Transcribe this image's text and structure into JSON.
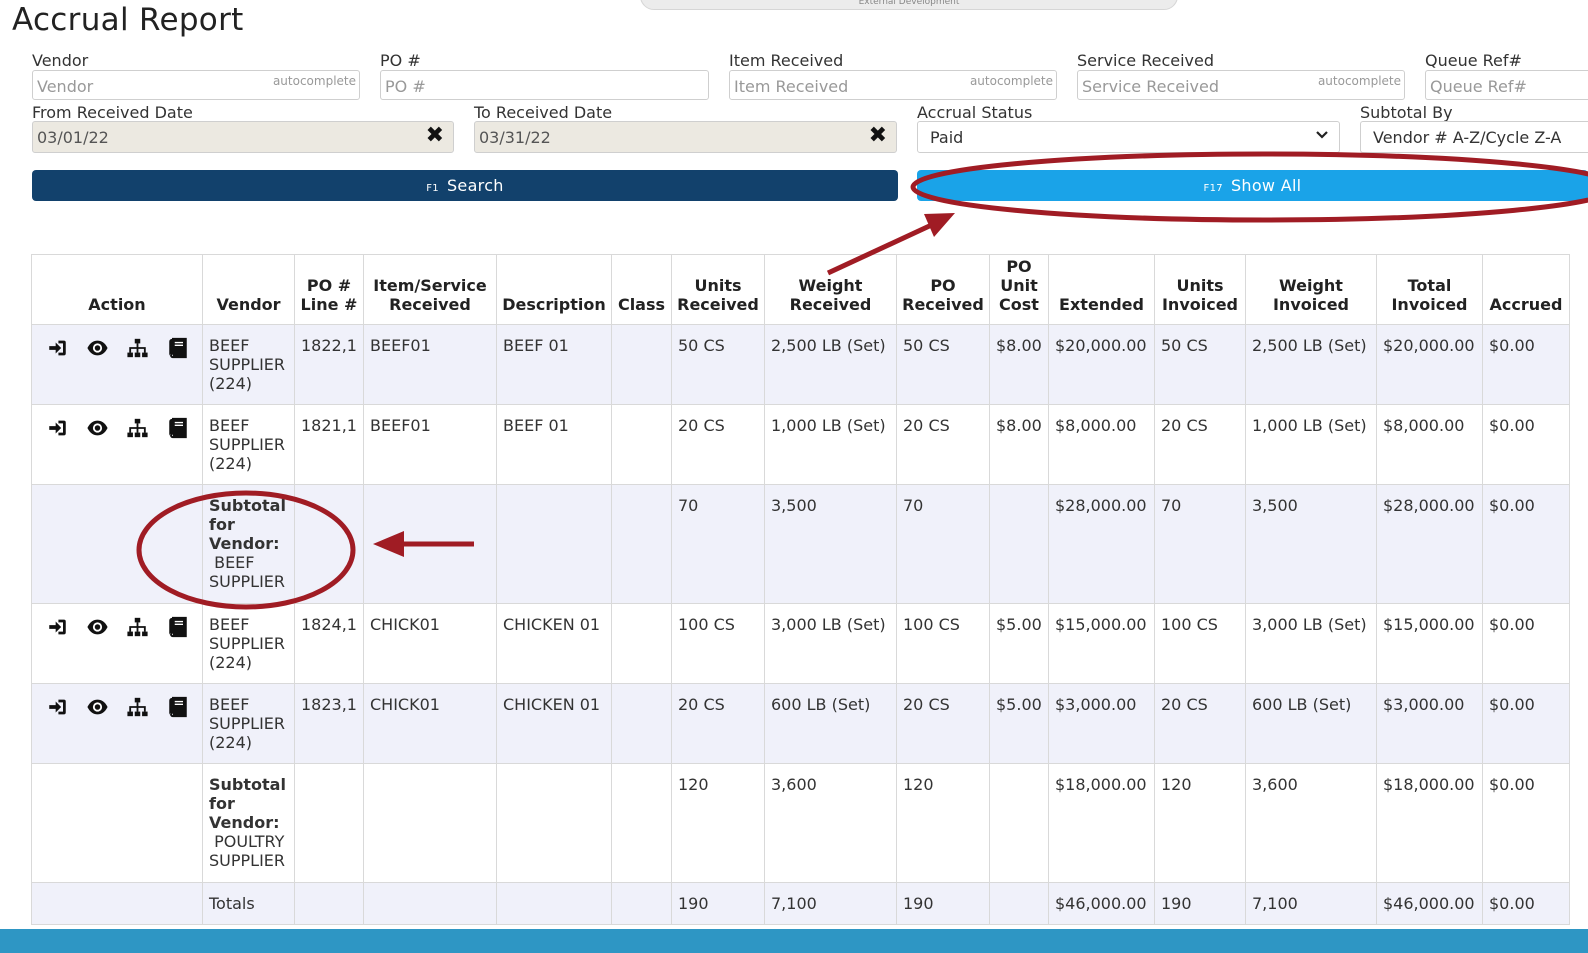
{
  "environment_tab": "External Development",
  "title": "Accrual Report",
  "filters": {
    "vendor": {
      "label": "Vendor",
      "placeholder": "Vendor",
      "hint": "autocomplete"
    },
    "po": {
      "label": "PO #",
      "placeholder": "PO #"
    },
    "item": {
      "label": "Item Received",
      "placeholder": "Item Received",
      "hint": "autocomplete"
    },
    "service": {
      "label": "Service Received",
      "placeholder": "Service Received",
      "hint": "autocomplete"
    },
    "queue": {
      "label": "Queue Ref#",
      "placeholder": "Queue Ref#"
    },
    "from_date": {
      "label": "From Received Date",
      "value": "03/01/22"
    },
    "to_date": {
      "label": "To Received Date",
      "value": "03/31/22"
    },
    "status": {
      "label": "Accrual Status",
      "value": "Paid"
    },
    "subtotal": {
      "label": "Subtotal By",
      "value": "Vendor # A-Z/Cycle Z-A"
    }
  },
  "buttons": {
    "search": {
      "key": "F1",
      "label": "Search"
    },
    "show_all": {
      "key": "F17",
      "label": "Show All"
    }
  },
  "table": {
    "headers": {
      "action": "Action",
      "vendor": "Vendor",
      "po_line": [
        "PO #",
        "Line #"
      ],
      "item": [
        "Item/Service",
        "Received"
      ],
      "description": "Description",
      "class": "Class",
      "units_received": [
        "Units",
        "Received"
      ],
      "weight_received": [
        "Weight",
        "Received"
      ],
      "po_received": [
        "PO",
        "Received"
      ],
      "po_unit_cost": [
        "PO",
        "Unit",
        "Cost"
      ],
      "extended": "Extended",
      "units_invoiced": [
        "Units",
        "Invoiced"
      ],
      "weight_invoiced": [
        "Weight",
        "Invoiced"
      ],
      "total_invoiced": [
        "Total",
        "Invoiced"
      ],
      "accrued": "Accrued"
    },
    "rows": [
      {
        "vendor": [
          "BEEF",
          "SUPPLIER",
          "(224)"
        ],
        "po_line": "1822,1",
        "item": "BEEF01",
        "description": "BEEF 01",
        "class": "",
        "units_received": "50 CS",
        "weight_received": "2,500 LB (Set)",
        "po_received": "50 CS",
        "po_unit_cost": "$8.00",
        "extended": "$20,000.00",
        "units_invoiced": "50 CS",
        "weight_invoiced": "2,500 LB (Set)",
        "total_invoiced": "$20,000.00",
        "accrued": "$0.00"
      },
      {
        "vendor": [
          "BEEF",
          "SUPPLIER",
          "(224)"
        ],
        "po_line": "1821,1",
        "item": "BEEF01",
        "description": "BEEF 01",
        "class": "",
        "units_received": "20 CS",
        "weight_received": "1,000 LB (Set)",
        "po_received": "20 CS",
        "po_unit_cost": "$8.00",
        "extended": "$8,000.00",
        "units_invoiced": "20 CS",
        "weight_invoiced": "1,000 LB (Set)",
        "total_invoiced": "$8,000.00",
        "accrued": "$0.00"
      },
      {
        "vendor": [
          "BEEF",
          "SUPPLIER",
          "(224)"
        ],
        "po_line": "1824,1",
        "item": "CHICK01",
        "description": "CHICKEN 01",
        "class": "",
        "units_received": "100 CS",
        "weight_received": "3,000 LB (Set)",
        "po_received": "100 CS",
        "po_unit_cost": "$5.00",
        "extended": "$15,000.00",
        "units_invoiced": "100 CS",
        "weight_invoiced": "3,000 LB (Set)",
        "total_invoiced": "$15,000.00",
        "accrued": "$0.00"
      },
      {
        "vendor": [
          "BEEF",
          "SUPPLIER",
          "(224)"
        ],
        "po_line": "1823,1",
        "item": "CHICK01",
        "description": "CHICKEN 01",
        "class": "",
        "units_received": "20 CS",
        "weight_received": "600 LB (Set)",
        "po_received": "20 CS",
        "po_unit_cost": "$5.00",
        "extended": "$3,000.00",
        "units_invoiced": "20 CS",
        "weight_invoiced": "600 LB (Set)",
        "total_invoiced": "$3,000.00",
        "accrued": "$0.00"
      }
    ],
    "subtotals": [
      {
        "label": [
          "Subtotal",
          "for",
          "Vendor:"
        ],
        "name": [
          "BEEF",
          "SUPPLIER"
        ],
        "units_received": "70",
        "weight_received": "3,500",
        "po_received": "70",
        "extended": "$28,000.00",
        "units_invoiced": "70",
        "weight_invoiced": "3,500",
        "total_invoiced": "$28,000.00",
        "accrued": "$0.00"
      },
      {
        "label": [
          "Subtotal",
          "for",
          "Vendor:"
        ],
        "name": [
          "POULTRY",
          "SUPPLIER"
        ],
        "units_received": "120",
        "weight_received": "3,600",
        "po_received": "120",
        "extended": "$18,000.00",
        "units_invoiced": "120",
        "weight_invoiced": "3,600",
        "total_invoiced": "$18,000.00",
        "accrued": "$0.00"
      }
    ],
    "totals": {
      "label": "Totals",
      "units_received": "190",
      "weight_received": "7,100",
      "po_received": "190",
      "extended": "$46,000.00",
      "units_invoiced": "190",
      "weight_invoiced": "7,100",
      "total_invoiced": "$46,000.00",
      "accrued": "$0.00"
    }
  },
  "icons": [
    "sign-in-icon",
    "eye-icon",
    "sitemap-icon",
    "book-icon",
    "close-icon",
    "chevron-down-icon"
  ],
  "colors": {
    "search_button": "#12416c",
    "show_all_button": "#1aa3e8",
    "annotation": "#a01c24",
    "row_shade": "#f0f1fa",
    "bottom_bar": "#2e96c4"
  }
}
